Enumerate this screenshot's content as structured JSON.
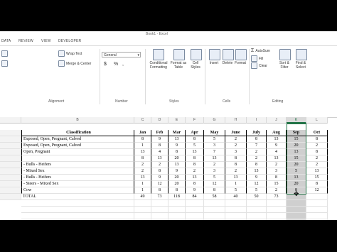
{
  "window": {
    "title_fragment": "Book1 - Excel"
  },
  "ribbon_tabs": [
    "DATA",
    "REVIEW",
    "VIEW",
    "DEVELOPER"
  ],
  "ribbon": {
    "wrap_text": "Wrap Text",
    "merge_center": "Merge & Center",
    "number_format": "General",
    "currency": "$",
    "percent": "%",
    "comma": ",",
    "conditional_formatting": "Conditional Formatting",
    "format_as_table": "Format as Table",
    "cell_styles": "Cell Styles",
    "insert": "Insert",
    "delete": "Delete",
    "format": "Format",
    "autosum": "AutoSum",
    "fill": "Fill",
    "clear": "Clear",
    "sort_filter": "Sort & Filter",
    "find_select": "Find & Select",
    "group_alignment": "Alignment",
    "group_number": "Number",
    "group_styles": "Styles",
    "group_cells": "Cells",
    "group_editing": "Editing"
  },
  "grid": {
    "column_letters": [
      "B",
      "C",
      "D",
      "E",
      "F",
      "G",
      "H",
      "I",
      "J",
      "K",
      "L"
    ],
    "selected_column": "K",
    "header": [
      "Classification",
      "Jan",
      "Feb",
      "Mar",
      "Apr",
      "May",
      "June",
      "July",
      "Aug",
      "Sep",
      "Oct"
    ],
    "rows": [
      {
        "label": "Exposed, Open, Pregnant, Calved",
        "values": [
          "8",
          "9",
          "13",
          "8",
          "5",
          "2",
          "8",
          "13",
          "15",
          "8"
        ]
      },
      {
        "label": "Exposed, Open, Pregnant, Calved",
        "values": [
          "1",
          "8",
          "9",
          "5",
          "3",
          "2",
          "7",
          "9",
          "20",
          "2"
        ]
      },
      {
        "label": "Open, Pregnant",
        "values": [
          "13",
          "4",
          "8",
          "13",
          "7",
          "3",
          "2",
          "4",
          "13",
          "8"
        ]
      },
      {
        "label": "",
        "values": [
          "8",
          "13",
          "20",
          "8",
          "13",
          "8",
          "2",
          "13",
          "15",
          "2"
        ]
      },
      {
        "label": "- Bulls       - Heifers",
        "values": [
          "2",
          "2",
          "13",
          "8",
          "2",
          "8",
          "8",
          "2",
          "20",
          "2"
        ]
      },
      {
        "label": "- Mixed Sex",
        "values": [
          "2",
          "8",
          "9",
          "2",
          "3",
          "2",
          "13",
          "3",
          "5",
          "13"
        ]
      },
      {
        "label": "- Bulls       - Heifers",
        "values": [
          "13",
          "9",
          "20",
          "13",
          "5",
          "13",
          "9",
          "8",
          "13",
          "15"
        ]
      },
      {
        "label": "- Steers       - Mixed Sex",
        "values": [
          "1",
          "12",
          "20",
          "8",
          "12",
          "1",
          "12",
          "15",
          "20",
          "8"
        ]
      },
      {
        "label": "Cow",
        "values": [
          "1",
          "8",
          "8",
          "9",
          "8",
          "5",
          "5",
          "2",
          "8",
          "12"
        ]
      }
    ],
    "total_label": "TOTAL",
    "totals": [
      "49",
      "73",
      "118",
      "84",
      "58",
      "40",
      "50",
      "73",
      "",
      ""
    ]
  }
}
